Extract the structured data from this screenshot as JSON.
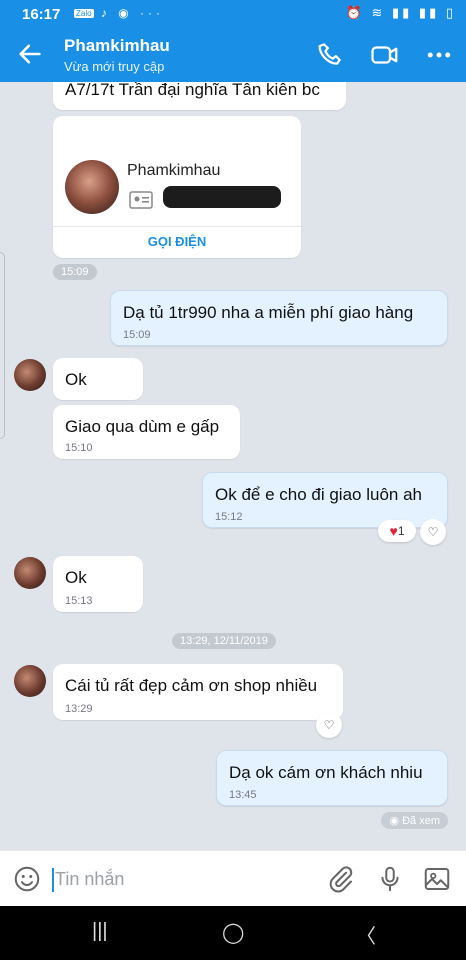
{
  "status_bar": {
    "time": "16:17",
    "zalo_label": "Zalo"
  },
  "header": {
    "contact_name": "Phamkimhau",
    "presence": "Vừa mới truy cập"
  },
  "colors": {
    "brand": "#1a8fe6",
    "sent_bubble": "#e4f2ff",
    "heart": "#e02435"
  },
  "contact_card": {
    "name": "Phamkimhau",
    "call_label": "GỌI ĐIỆN",
    "address_text": "A7/17t Trần đại nghĩa Tân kiên bc"
  },
  "messages": [
    {
      "id": "m1",
      "side": "received",
      "text": "",
      "time": "15:09"
    },
    {
      "id": "m2",
      "side": "sent",
      "text": "Dạ tủ 1tr990 nha a miễn phí giao hàng",
      "time": "15:09"
    },
    {
      "id": "m3",
      "side": "received",
      "text": "Ok",
      "time": ""
    },
    {
      "id": "m4",
      "side": "received",
      "text": "Giao qua dùm e gấp",
      "time": "15:10"
    },
    {
      "id": "m5",
      "side": "sent",
      "text": "Ok để e cho đi giao luôn ah",
      "time": "15:12",
      "reaction_count": "1"
    },
    {
      "id": "m6",
      "side": "received",
      "text": "Ok",
      "time": "15:13"
    },
    {
      "id": "m7",
      "side": "received",
      "text": "Cái tủ rất đẹp cảm ơn shop nhiều",
      "time": "13:29"
    },
    {
      "id": "m8",
      "side": "sent",
      "text": "Dạ ok cám ơn khách nhiu",
      "time": "13:45"
    }
  ],
  "date_divider": "13:29, 12/11/2019",
  "seen_label": "Đã xem",
  "composer": {
    "placeholder": "Tin nhắn"
  }
}
